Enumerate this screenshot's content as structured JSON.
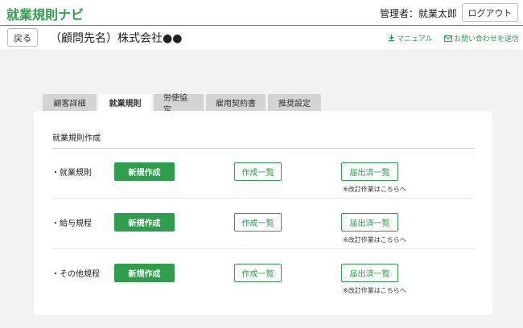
{
  "header": {
    "app_title": "就業規則ナビ",
    "admin_label": "管理者：就業太郎",
    "logout_label": "ログアウト",
    "accent_color": "#2e9e4d"
  },
  "subheader": {
    "back_label": "戻る",
    "client_name": "（顧問先名）株式会社●●",
    "manual_link": "マニュアル",
    "manual_icon": "download-icon",
    "contact_link": "お問い合わせを送信",
    "contact_icon": "mail-icon"
  },
  "tabs": [
    {
      "label": "顧客詳細",
      "active": false
    },
    {
      "label": "就業規則",
      "active": true
    },
    {
      "label": "労使協定",
      "active": false
    },
    {
      "label": "雇用契約書",
      "active": false
    },
    {
      "label": "推奨設定",
      "active": false
    }
  ],
  "card": {
    "title": "就業規則作成",
    "rows": [
      {
        "label": "・就業規則",
        "new_label": "新規作成",
        "list_label": "作成一覧",
        "filed_label": "届出済一覧",
        "note": "※改訂作業はこちらへ"
      },
      {
        "label": "・給与規程",
        "new_label": "新規作成",
        "list_label": "作成一覧",
        "filed_label": "届出済一覧",
        "note": "※改訂作業はこちらへ"
      },
      {
        "label": "・その他規程",
        "new_label": "新規作成",
        "list_label": "作成一覧",
        "filed_label": "届出済一覧",
        "note": "※改訂作業はこちらへ"
      }
    ]
  }
}
